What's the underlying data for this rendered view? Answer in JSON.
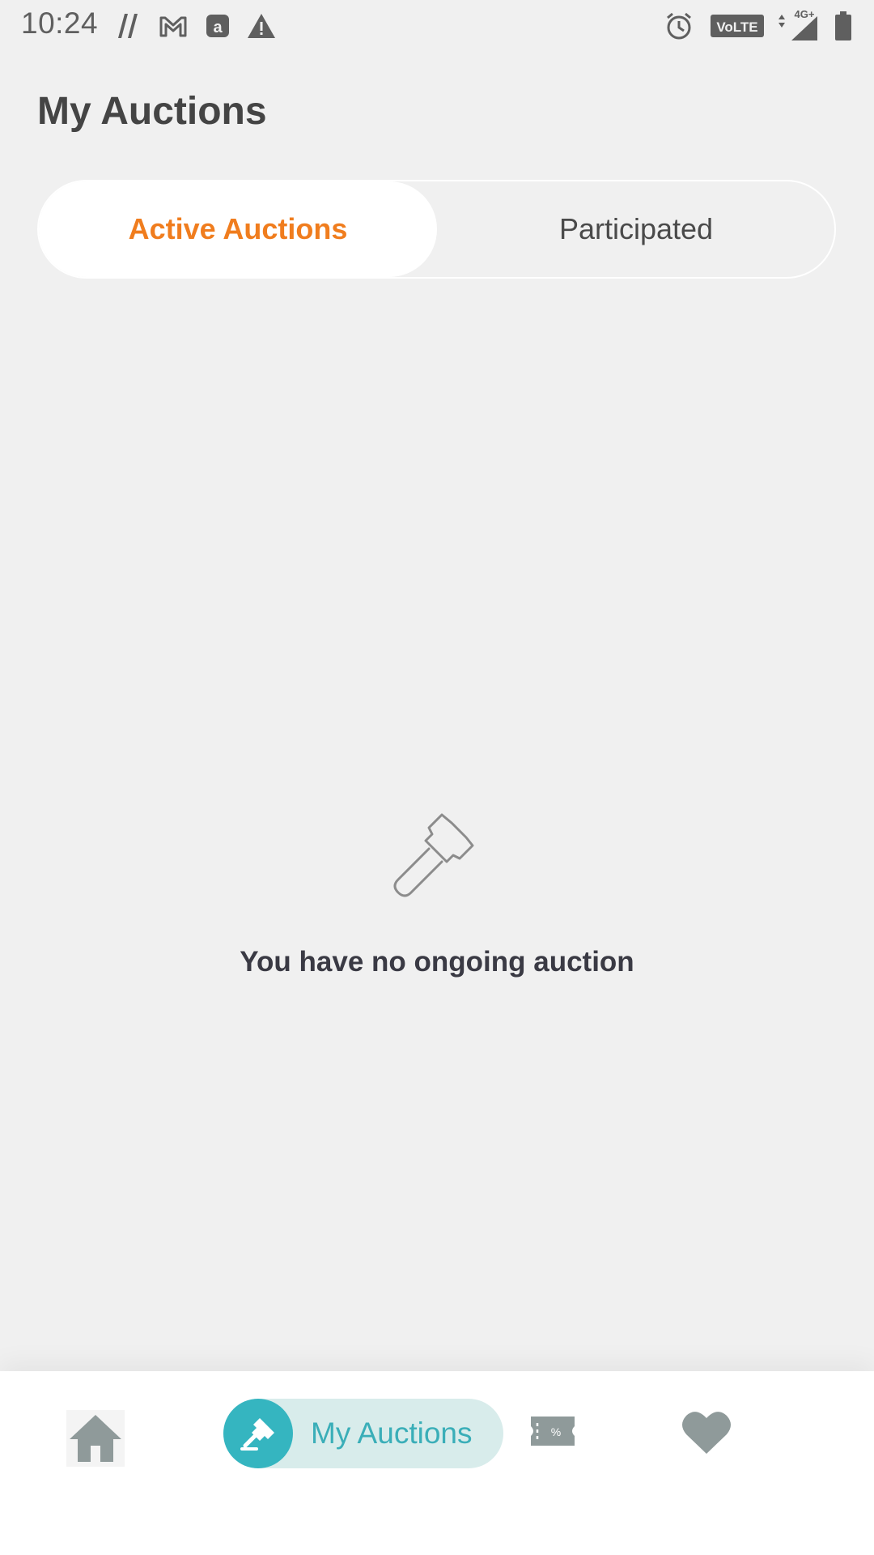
{
  "status_bar": {
    "time": "10:24",
    "network_label": "4G+",
    "volte_label": "VoLTE",
    "left_icons": [
      "nfc-icon",
      "gmail-icon",
      "amazon-icon",
      "warning-icon"
    ],
    "right_icons": [
      "alarm-icon",
      "volte-icon",
      "signal-icon",
      "battery-icon"
    ]
  },
  "header": {
    "title": "My Auctions"
  },
  "tabs": [
    {
      "label": "Active Auctions",
      "active": true
    },
    {
      "label": "Participated",
      "active": false
    }
  ],
  "empty_state": {
    "icon": "gavel-icon",
    "message": "You have no ongoing auction"
  },
  "bottom_nav": {
    "items": [
      {
        "icon": "home-icon",
        "label": ""
      },
      {
        "icon": "gavel-icon",
        "label": "My Auctions",
        "active": true
      },
      {
        "icon": "coupon-icon",
        "label": ""
      },
      {
        "icon": "heart-icon",
        "label": ""
      }
    ]
  },
  "colors": {
    "accent_orange": "#f07d1e",
    "accent_teal": "#35b5c0",
    "active_pill_bg": "#d8eceb",
    "background": "#f0f0f0",
    "icon_gray": "#8f9a9a"
  }
}
